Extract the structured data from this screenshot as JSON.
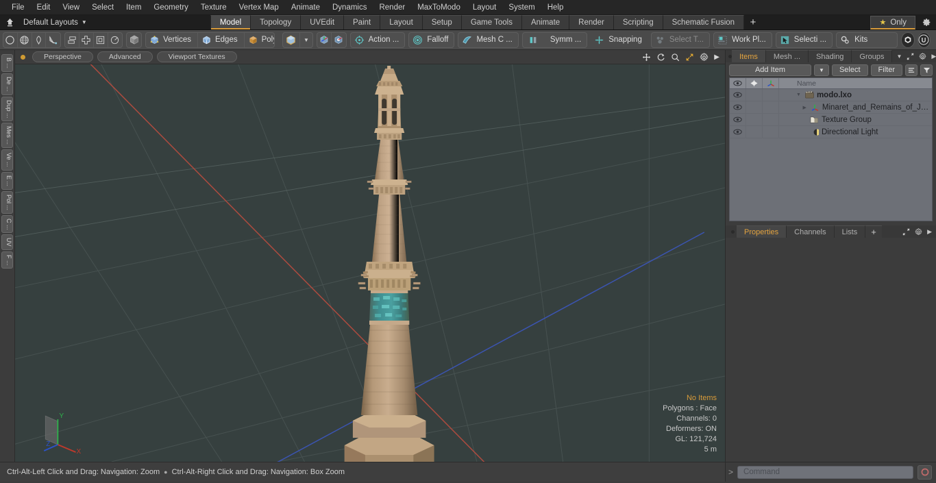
{
  "menubar": {
    "items": [
      "File",
      "Edit",
      "View",
      "Select",
      "Item",
      "Geometry",
      "Texture",
      "Vertex Map",
      "Animate",
      "Dynamics",
      "Render",
      "MaxToModo",
      "Layout",
      "System",
      "Help"
    ]
  },
  "layoutbar": {
    "home_icon": "home-icon",
    "layouts_label": "Default Layouts",
    "tabs": [
      {
        "label": "Model",
        "active": true
      },
      {
        "label": "Topology",
        "active": false
      },
      {
        "label": "UVEdit",
        "active": false
      },
      {
        "label": "Paint",
        "active": false
      },
      {
        "label": "Layout",
        "active": false
      },
      {
        "label": "Setup",
        "active": false
      },
      {
        "label": "Game Tools",
        "active": false
      },
      {
        "label": "Animate",
        "active": false
      },
      {
        "label": "Render",
        "active": false
      },
      {
        "label": "Scripting",
        "active": false
      },
      {
        "label": "Schematic Fusion",
        "active": false
      }
    ],
    "add_tab_label": "+",
    "only_label": "Only",
    "only_star_color": "#e8c84a",
    "accent_color": "#d89b3a"
  },
  "toolbar": {
    "shape_tools": [
      "circle-icon",
      "globe-icon",
      "pen-icon",
      "curve-icon"
    ],
    "arrange_tools": [
      "align-icon",
      "center-icon",
      "frame-icon",
      "radial-icon"
    ],
    "element_cube": "cube-icon",
    "selection_modes": [
      {
        "label": "Vertices",
        "icon": "vertex-cube-icon"
      },
      {
        "label": "Edges",
        "icon": "edge-cube-icon"
      },
      {
        "label": "Polygons",
        "icon": "polygon-cube-icon"
      }
    ],
    "item_mode_icon": "item-cube-icon",
    "item_caret": "chevron-down-icon",
    "pivot_tools": [
      "pivot-icon",
      "center-pivot-icon"
    ],
    "mode_buttons": [
      {
        "label": "Action  ...",
        "icon": "action-center-icon"
      },
      {
        "label": "Falloff",
        "icon": "falloff-icon"
      },
      {
        "label": "Mesh C ...",
        "icon": "mesh-constraint-icon"
      },
      {
        "label": "Symm ...",
        "icon": "symmetry-icon"
      },
      {
        "label": "Snapping",
        "icon": "snapping-icon"
      },
      {
        "label": "Select T...",
        "icon": "select-through-icon",
        "dim": true
      },
      {
        "label": "Work Pl...",
        "icon": "work-plane-icon"
      },
      {
        "label": "Selecti ...",
        "icon": "selection-icon"
      }
    ],
    "kits_label": "Kits",
    "kits_icon": "gears-icon",
    "app_icons": [
      "modo-icon",
      "unreal-icon"
    ]
  },
  "left_strip": {
    "tabs": [
      "B ...",
      "De ...",
      "Dup ...",
      "Mes ...",
      "Ve ...",
      "E ...",
      "Pol ...",
      "C ...",
      "UV",
      "F ..."
    ]
  },
  "viewport": {
    "dot_color": "#d09b33",
    "pills": [
      "Perspective",
      "Advanced",
      "Viewport Textures"
    ],
    "nav_icons": [
      "move-icon",
      "rotate-icon",
      "zoom-icon",
      "fit-icon",
      "gear-icon",
      "chevron-right-icon"
    ],
    "background_color": "#36403f",
    "model_name": "Minaret and Remains of Jam",
    "model_color": "#c3a584",
    "accent_band_color": "#2e8f93",
    "axis": {
      "x": "X",
      "y": "Y",
      "z": "Z",
      "x_color": "#c0392b",
      "y_color": "#2db24a",
      "z_color": "#2b52c9"
    },
    "info": {
      "selection": "No Items",
      "polygons": "Polygons : Face",
      "channels": "Channels: 0",
      "deformers": "Deformers: ON",
      "gl": "GL: 121,724",
      "scale": "5 m"
    }
  },
  "items_panel": {
    "tabs": [
      {
        "label": "Items",
        "active": true
      },
      {
        "label": "Mesh ...",
        "active": false
      },
      {
        "label": "Shading",
        "active": false
      },
      {
        "label": "Groups",
        "active": false
      }
    ],
    "tab_icons": [
      "chevron-down-icon",
      "expand-icon",
      "gear-icon",
      "chevron-right-icon"
    ],
    "toolbar": {
      "add_item": "Add Item",
      "add_item_caret": "chevron-down-icon",
      "select": "Select",
      "filter": "Filter",
      "list_icon": "list-icon",
      "funnel_icon": "funnel-icon"
    },
    "columns": [
      "eye-icon",
      "plus-icon",
      "axis-icon",
      "Name"
    ],
    "rows": [
      {
        "name": "modo.lxo",
        "icon": "scene-icon",
        "depth": 0,
        "bold": true,
        "expander": "triangle-down"
      },
      {
        "name": "Minaret_and_Remains_of_Ja ...",
        "icon": "mesh-axis-icon",
        "depth": 1,
        "bold": false,
        "expander": "triangle-right"
      },
      {
        "name": "Texture Group",
        "icon": "texture-group-icon",
        "depth": 1,
        "bold": false,
        "expander": "none"
      },
      {
        "name": "Directional Light",
        "icon": "light-icon",
        "depth": 1,
        "bold": false,
        "expander": "none"
      }
    ]
  },
  "properties_panel": {
    "tabs": [
      {
        "label": "Properties",
        "active": true
      },
      {
        "label": "Channels",
        "active": false
      },
      {
        "label": "Lists",
        "active": false
      },
      {
        "label": "+",
        "active": false
      }
    ],
    "tab_icons": [
      "expand-icon",
      "gear-icon",
      "chevron-right-icon"
    ]
  },
  "statusbar": {
    "hint_left": "Ctrl-Alt-Left Click and Drag: Navigation: Zoom",
    "hint_separator": "●",
    "hint_right": "Ctrl-Alt-Right Click and Drag: Navigation: Box Zoom",
    "command_prompt": ">",
    "command_placeholder": "Command",
    "command_value": "",
    "record_icon": "record-icon"
  }
}
